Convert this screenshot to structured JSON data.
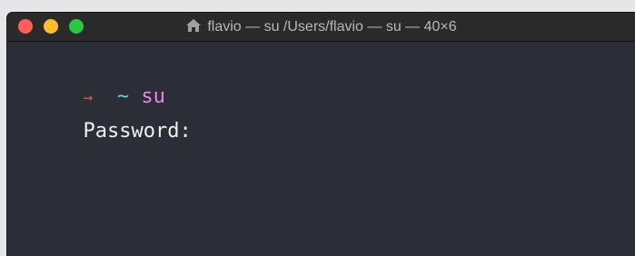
{
  "window": {
    "title": "flavio — su /Users/flavio — su — 40×6",
    "colors": {
      "background": "#2b2d37",
      "close": "#ff5f57",
      "minimize": "#febc2e",
      "zoom": "#28c840"
    }
  },
  "terminal": {
    "lines": [
      {
        "prompt_arrow": "→",
        "prompt_dir": "~",
        "command": "su"
      },
      {
        "text": "Password:"
      }
    ],
    "colors": {
      "arrow": "#e35a3a",
      "dir": "#5fd3e8",
      "command": "#e68ae6",
      "text": "#f0f0f0"
    }
  },
  "icons": {
    "title": "home-icon",
    "close": "close-icon",
    "minimize": "minimize-icon",
    "zoom": "zoom-icon"
  }
}
